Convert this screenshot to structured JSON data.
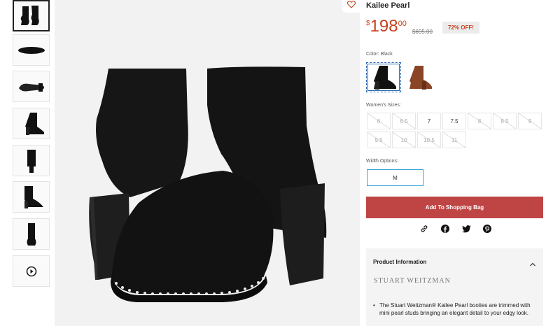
{
  "product": {
    "name": "Kailee Pearl",
    "price_currency": "$",
    "price_whole": "198",
    "price_cents": "00",
    "old_price": "$695.00",
    "discount_badge": "72% OFF!"
  },
  "color": {
    "label": "Color:",
    "selected": "Black",
    "swatches": [
      "black-bootie",
      "brown-bootie"
    ]
  },
  "sizes": {
    "label": "Women's Sizes:",
    "options": [
      {
        "label": "6",
        "available": false
      },
      {
        "label": "6.5",
        "available": false
      },
      {
        "label": "7",
        "available": true
      },
      {
        "label": "7.5",
        "available": true
      },
      {
        "label": "8",
        "available": false
      },
      {
        "label": "8.5",
        "available": false
      },
      {
        "label": "9",
        "available": false
      },
      {
        "label": "9.5",
        "available": false
      },
      {
        "label": "10",
        "available": false
      },
      {
        "label": "10.5",
        "available": false
      },
      {
        "label": "11",
        "available": false
      }
    ]
  },
  "width": {
    "label": "Width Options:",
    "selected": "M"
  },
  "actions": {
    "add_to_bag": "Add To Shopping Bag",
    "share_icons": [
      "link-icon",
      "facebook-icon",
      "twitter-icon",
      "pinterest-icon"
    ]
  },
  "info": {
    "heading": "Product Information",
    "brand": "STUART WEITZMAN",
    "bullet": "The Stuart Weitzman® Kailee Pearl booties are trimmed with mini pearl studs bringing an elegant detail to your edgy look."
  },
  "colors": {
    "price": "#c7401d",
    "add_button": "#bf4545",
    "selected_border": "#2a6bb5",
    "width_border": "#2f9fd4"
  }
}
